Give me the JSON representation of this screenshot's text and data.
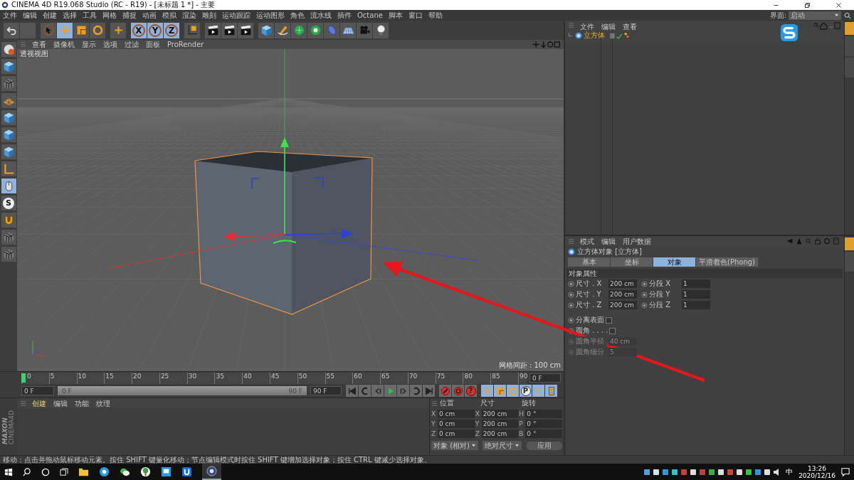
{
  "window": {
    "title": "CINEMA 4D R19.068 Studio (RC - R19) - [未标题 1 *] - 主要"
  },
  "menu": [
    "文件",
    "编辑",
    "创建",
    "选择",
    "工具",
    "网格",
    "捕捉",
    "动画",
    "模拟",
    "渲染",
    "雕刻",
    "运动跟踪",
    "运动图形",
    "角色",
    "流水线",
    "插件",
    "Octane",
    "脚本",
    "窗口",
    "帮助"
  ],
  "layout_selector": {
    "label": "界面:",
    "value": "启动"
  },
  "toolbar": [
    {
      "kind": "undo",
      "selected": false
    },
    {
      "kind": "redo",
      "selected": false
    },
    {
      "kind": "select",
      "selected": false
    },
    {
      "kind": "move",
      "selected": true
    },
    {
      "kind": "scale",
      "selected": false
    },
    {
      "kind": "rotate",
      "selected": false
    },
    {
      "kind": "add",
      "selected": false
    },
    {
      "kind": "axis",
      "label": "X",
      "selected": true
    },
    {
      "kind": "axis",
      "label": "Y",
      "selected": true
    },
    {
      "kind": "axis",
      "label": "Z",
      "selected": true
    },
    {
      "kind": "coord",
      "selected": false
    },
    {
      "kind": "clap",
      "selected": false
    },
    {
      "kind": "clap",
      "selected": false
    },
    {
      "kind": "clap",
      "selected": false
    },
    {
      "kind": "cube",
      "selected": false
    },
    {
      "kind": "pen",
      "selected": false
    },
    {
      "kind": "subdiv",
      "selected": false
    },
    {
      "kind": "cloner",
      "selected": false
    },
    {
      "kind": "deformer",
      "selected": false
    },
    {
      "kind": "floor",
      "selected": false
    },
    {
      "kind": "camera",
      "selected": false
    },
    {
      "kind": "light",
      "selected": false
    }
  ],
  "left_tools": [
    {
      "kind": "sphere",
      "selected": false
    },
    {
      "kind": "cube",
      "selected": false
    },
    {
      "kind": "checker",
      "selected": false
    },
    {
      "kind": "plane",
      "selected": false
    },
    {
      "kind": "cube",
      "selected": false
    },
    {
      "kind": "cube",
      "selected": false
    },
    {
      "kind": "cube",
      "selected": false
    },
    {
      "kind": "axis",
      "selected": false
    },
    {
      "kind": "mouse",
      "selected": true
    },
    {
      "kind": "snap",
      "label": "S",
      "selected": false
    },
    {
      "kind": "magnet",
      "selected": false
    },
    {
      "kind": "checker",
      "selected": false
    },
    {
      "kind": "checker",
      "selected": false
    }
  ],
  "viewport": {
    "menu": [
      "查看",
      "摄像机",
      "显示",
      "选项",
      "过滤",
      "面板",
      "ProRender"
    ],
    "view_name": "透视视图",
    "grid_spacing": "网格间距 : 100 cm"
  },
  "object_manager": {
    "menu": [
      "文件",
      "编辑",
      "查看"
    ],
    "objects": [
      {
        "name": "立方体",
        "selected": true
      }
    ]
  },
  "attribute_manager": {
    "menu": [
      "模式",
      "编辑",
      "用户数据"
    ],
    "title": "立方体对象 [立方体]",
    "tabs": [
      {
        "label": "基本",
        "selected": false
      },
      {
        "label": "坐标",
        "selected": false
      },
      {
        "label": "对象",
        "selected": true
      },
      {
        "label": "平滑着色(Phong)",
        "selected": false
      }
    ],
    "section": "对象属性",
    "params": [
      {
        "kind": "pair",
        "label": "尺寸 . X",
        "value": "200 cm",
        "label2": "分段 X",
        "value2": "1"
      },
      {
        "kind": "pair",
        "label": "尺寸 . Y",
        "value": "200 cm",
        "label2": "分段 Y",
        "value2": "1"
      },
      {
        "kind": "pair",
        "label": "尺寸 . Z",
        "value": "200 cm",
        "label2": "分段 Z",
        "value2": "1"
      },
      {
        "kind": "check",
        "label": "分离表面",
        "checked": false
      },
      {
        "kind": "check",
        "label": "圆角 . . . .",
        "checked": false
      },
      {
        "kind": "field",
        "label": "圆角半径",
        "value": "40 cm",
        "disabled": true
      },
      {
        "kind": "field",
        "label": "圆角细分",
        "value": "5",
        "disabled": true
      }
    ]
  },
  "object_side_tabs": [
    {
      "selected": true
    },
    {
      "selected": false
    },
    {
      "selected": false
    }
  ],
  "attribute_side_tabs": [
    {
      "selected": true
    },
    {
      "selected": false
    }
  ],
  "timeline": {
    "range": {
      "level": 1
    },
    "ticks": [
      "0",
      "5",
      "10",
      "15",
      "20",
      "25",
      "30",
      "35",
      "40",
      "45",
      "50",
      "55",
      "60",
      "65",
      "70",
      "75",
      "80",
      "85",
      "90"
    ],
    "playhead": {
      "level": 0
    },
    "current": "0 F",
    "start": "0 F",
    "range_start": "0 F",
    "range_end": "90 F",
    "end": "90 F"
  },
  "transport": [
    {
      "kind": "to_start"
    },
    {
      "kind": "loop_back"
    },
    {
      "kind": "step_back"
    },
    {
      "kind": "play"
    },
    {
      "kind": "step_forward"
    },
    {
      "kind": "loop"
    },
    {
      "kind": "to_end"
    },
    {
      "kind": "record"
    },
    {
      "kind": "autokey"
    },
    {
      "kind": "key",
      "label": "?"
    },
    {
      "kind": "move"
    },
    {
      "kind": "scale"
    },
    {
      "kind": "rotate"
    },
    {
      "kind": "param",
      "label": "P"
    },
    {
      "kind": "points"
    },
    {
      "kind": "film"
    }
  ],
  "material_manager": {
    "menu": [
      "创建",
      "编辑",
      "功能",
      "纹理"
    ]
  },
  "coordinates": {
    "headers": [
      "位置",
      "尺寸",
      "旋转"
    ],
    "rows": [
      [
        {
          "axis": "X",
          "value": "0 cm"
        },
        {
          "axis": "X",
          "value": "200 cm"
        },
        {
          "axis": "H",
          "value": "0 °"
        }
      ],
      [
        {
          "axis": "Y",
          "value": "0 cm"
        },
        {
          "axis": "Y",
          "value": "200 cm"
        },
        {
          "axis": "P",
          "value": "0 °"
        }
      ],
      [
        {
          "axis": "Z",
          "value": "0 cm"
        },
        {
          "axis": "Z",
          "value": "200 cm"
        },
        {
          "axis": "B",
          "value": "0 °"
        }
      ]
    ],
    "dropdowns": [
      "对象 (相对)",
      "绝对尺寸"
    ],
    "apply": "应用"
  },
  "logo": {
    "brand": "MAXON",
    "product": "CINEMA4D"
  },
  "status_bar": "移动：点击并拖动鼠标移动元素。按住 SHIFT 键量化移动；节点编辑模式时按住 SHIFT 键增加选择对象；按住 CTRL 键减少选择对象。",
  "taskbar": {
    "input_method": "中",
    "time": "13:26",
    "date": "2020/12/16"
  }
}
